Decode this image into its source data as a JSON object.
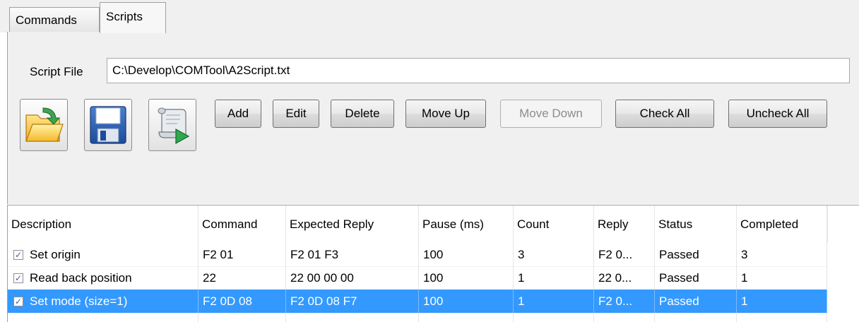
{
  "tabs": [
    {
      "label": "Commands",
      "active": false
    },
    {
      "label": "Scripts",
      "active": true
    }
  ],
  "script_file": {
    "label": "Script File",
    "value": "C:\\Develop\\COMTool\\A2Script.txt"
  },
  "toolbar": {
    "open_icon": "folder-open-icon",
    "save_icon": "floppy-save-icon",
    "run_icon": "script-run-icon",
    "add": "Add",
    "edit": "Edit",
    "delete": "Delete",
    "move_up": "Move Up",
    "move_down": "Move Down",
    "check_all": "Check All",
    "uncheck_all": "Uncheck All"
  },
  "table": {
    "columns": [
      "Description",
      "Command",
      "Expected Reply",
      "Pause (ms)",
      "Count",
      "Reply",
      "Status",
      "Completed"
    ],
    "rows": [
      {
        "checked": true,
        "description": "Set origin",
        "command": "F2 01",
        "expected_reply": "F2 01 F3",
        "pause": "100",
        "count": "3",
        "reply": "F2 0...",
        "status": "Passed",
        "completed": "3",
        "selected": false
      },
      {
        "checked": true,
        "description": "Read back position",
        "command": "22",
        "expected_reply": "22 00 00 00",
        "pause": "100",
        "count": "1",
        "reply": "22 0...",
        "status": "Passed",
        "completed": "1",
        "selected": false
      },
      {
        "checked": true,
        "description": "Set mode (size=1)",
        "command": "F2 0D 08",
        "expected_reply": "F2 0D 08 F7",
        "pause": "100",
        "count": "1",
        "reply": "F2 0...",
        "status": "Passed",
        "completed": "1",
        "selected": true
      }
    ]
  },
  "colors": {
    "selection": "#3399ff",
    "panel": "#f0f0f0"
  }
}
